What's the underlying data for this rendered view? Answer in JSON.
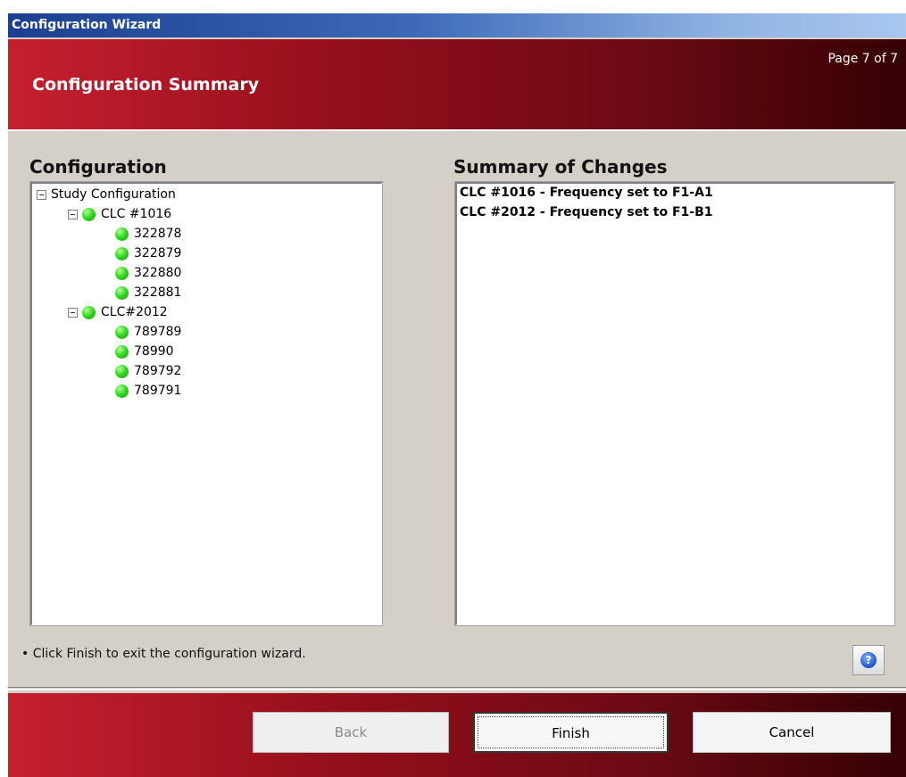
{
  "window": {
    "title": "Configuration Wizard"
  },
  "header": {
    "title": "Configuration Summary",
    "page_indicator": "Page 7 of 7"
  },
  "left": {
    "heading": "Configuration",
    "tree": {
      "root": "Study Configuration",
      "groups": [
        {
          "label": "CLC #1016",
          "status_icon": "green-status-dot",
          "items": [
            "322878",
            "322879",
            "322880",
            "322881"
          ]
        },
        {
          "label": "CLC#2012",
          "status_icon": "green-status-dot",
          "items": [
            "789789",
            "78990",
            "789792",
            "789791"
          ]
        }
      ]
    }
  },
  "right": {
    "heading": "Summary of Changes",
    "changes": [
      "CLC #1016 - Frequency set to F1-A1",
      "CLC #2012 - Frequency set to F1-B1"
    ]
  },
  "hint": "• Click Finish to exit the configuration wizard.",
  "help": {
    "icon": "question-icon",
    "glyph": "?"
  },
  "buttons": {
    "back": "Back",
    "finish": "Finish",
    "cancel": "Cancel"
  },
  "colors": {
    "accent_red": "#c6202f",
    "status_green": "#33dd22",
    "titlebar_blue": "#1c3f8f"
  }
}
